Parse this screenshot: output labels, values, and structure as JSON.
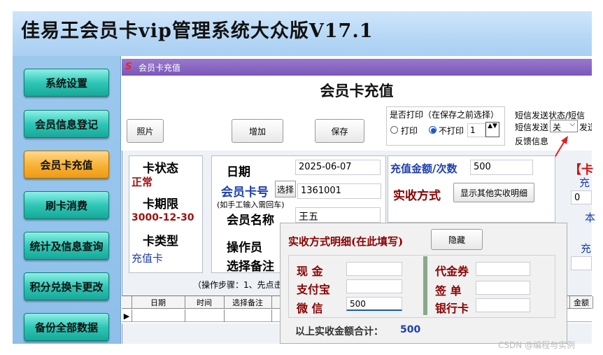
{
  "app_title": "佳易王会员卡vip管理系统大众版V17.1",
  "sidebar": {
    "items": [
      {
        "label": "系统设置"
      },
      {
        "label": "会员信息登记"
      },
      {
        "label": "会员卡充值"
      },
      {
        "label": "刷卡消费"
      },
      {
        "label": "统计及信息查询"
      },
      {
        "label": "积分兑换卡更改"
      },
      {
        "label": "备份全部数据"
      }
    ],
    "active_index": 2
  },
  "dialog": {
    "window_title": "会员卡充值",
    "heading": "会员卡充值",
    "buttons": {
      "photo": "照片",
      "add": "增加",
      "save": "保存"
    },
    "print": {
      "question": "是否打印（在保存之前选择）",
      "option_print": "打印",
      "option_no_print": "不打印",
      "selected": "不打印",
      "copies": "1",
      "spinner": "▲▼"
    },
    "sms": {
      "line1": "短信发送状态/短信",
      "line2_label": "短信发送",
      "select_value": "关",
      "line2_suffix": "发送",
      "feedback": "反馈信息"
    },
    "card_status": {
      "status_label": "卡状态",
      "status_value": "正常",
      "expiry_label": "卡期限",
      "expiry_value": "3000-12-30",
      "type_label": "卡类型",
      "type_value": "充值卡"
    },
    "form": {
      "date_label": "日期",
      "date_value": "2025-06-07",
      "card_no_label": "会员卡号",
      "select_button": "选择",
      "card_no_value": "1361001",
      "card_hint": "(如手工输入需回车)",
      "name_label": "会员名称",
      "name_value": "王五",
      "operator_label": "操作员",
      "remark_label": "选择备注"
    },
    "recharge": {
      "amount_label": "充值金额/次数",
      "amount_value": "500",
      "method_label": "实收方式",
      "show_detail_button": "显示其他实收明细"
    },
    "right_partial": {
      "bracket": "【卡",
      "l1": "充",
      "v1": "0",
      "l2": "本",
      "l3": "充"
    },
    "steps_text": "（操作步骤：1、先点击",
    "grid": {
      "columns": [
        "日期",
        "时间",
        "选择备注"
      ],
      "right_column": "金额",
      "row_marker": "▶"
    },
    "popup": {
      "title": "实收方式明细(在此填写)",
      "hide_button": "隐藏",
      "cash_label": "现  金",
      "cash_value": "",
      "alipay_label": "支付宝",
      "alipay_value": "",
      "wechat_label": "微  信",
      "wechat_value": "500",
      "voucher_label": "代金券",
      "voucher_value": "",
      "bill_label": "签  单",
      "bill_value": "",
      "bank_label": "银行卡",
      "bank_value": "",
      "total_label": "以上实收金额合计：",
      "total_value": "500"
    }
  },
  "watermark": "CSDN @编程与实例"
}
